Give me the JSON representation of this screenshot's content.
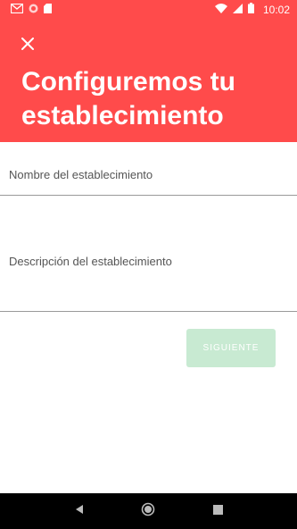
{
  "status_bar": {
    "time": "10:02",
    "icons": [
      "gmail-icon",
      "notification-dot-icon",
      "sd-card-icon",
      "wifi-icon",
      "signal-icon",
      "battery-icon"
    ]
  },
  "header": {
    "close_icon": "close-icon",
    "title": "Configuremos tu establecimiento",
    "background_color": "#ff4b4b"
  },
  "form": {
    "name_field": {
      "placeholder": "Nombre del establecimiento",
      "value": ""
    },
    "description_field": {
      "placeholder": "Descripción del establecimiento",
      "value": ""
    },
    "next_button": {
      "label": "SIGUIENTE",
      "color": "#c8ead2",
      "enabled": false
    }
  },
  "nav_bar": {
    "items": [
      "back-icon",
      "home-icon",
      "recents-icon"
    ]
  }
}
